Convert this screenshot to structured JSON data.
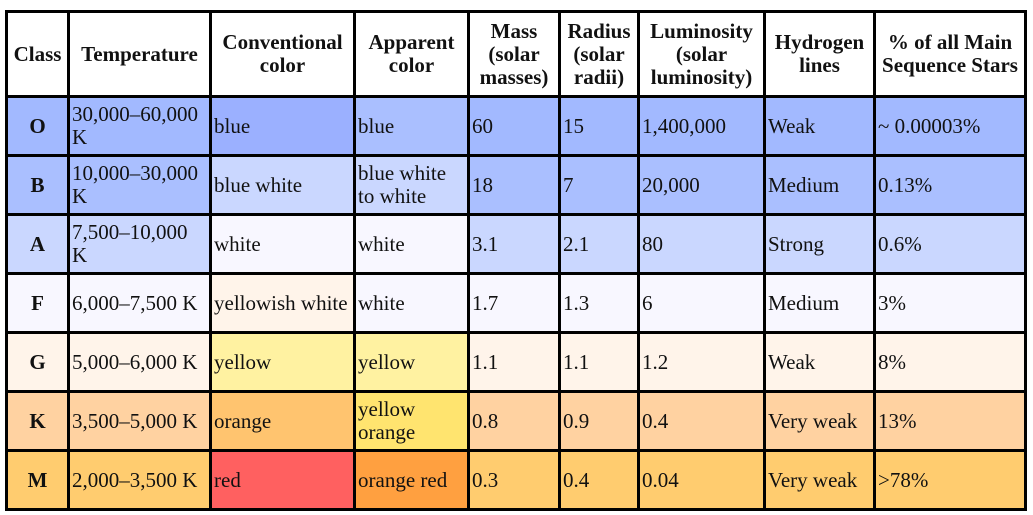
{
  "headers": [
    "Class",
    "Temperature",
    "Conventional color",
    "Apparent color",
    "Mass (solar masses)",
    "Radius (solar radii)",
    "Luminosity (solar luminosity)",
    "Hydrogen lines",
    "% of all Main Sequence Stars"
  ],
  "rows": [
    {
      "cls": "O",
      "temp": "30,000–60,000 K",
      "conv": "blue",
      "app": "blue",
      "mass": "60",
      "radius": "15",
      "lum": "1,400,000",
      "hyd": "Weak",
      "pct": "~ 0.00003%",
      "row_bg": "#a2b9ff",
      "conv_bg": "#9bb0ff",
      "app_bg": "#aabfff"
    },
    {
      "cls": "B",
      "temp": "10,000–30,000 K",
      "conv": "blue white",
      "app": "blue white to white",
      "mass": "18",
      "radius": "7",
      "lum": "20,000",
      "hyd": "Medium",
      "pct": "0.13%",
      "row_bg": "#aabfff",
      "conv_bg": "#cad7ff",
      "app_bg": "#cad7ff"
    },
    {
      "cls": "A",
      "temp": "7,500–10,000 K",
      "conv": "white",
      "app": "white",
      "mass": "3.1",
      "radius": "2.1",
      "lum": "80",
      "hyd": "Strong",
      "pct": "0.6%",
      "row_bg": "#cad7ff",
      "conv_bg": "#f8f7ff",
      "app_bg": "#f8f7ff"
    },
    {
      "cls": "F",
      "temp": "6,000–7,500 K",
      "conv": "yellowish white",
      "app": "white",
      "mass": "1.7",
      "radius": "1.3",
      "lum": "6",
      "hyd": "Medium",
      "pct": "3%",
      "row_bg": "#f8f7ff",
      "conv_bg": "#fff4ea",
      "app_bg": "#f8f7ff"
    },
    {
      "cls": "G",
      "temp": "5,000–6,000 K",
      "conv": "yellow",
      "app": "yellow",
      "mass": "1.1",
      "radius": "1.1",
      "lum": "1.2",
      "hyd": "Weak",
      "pct": "8%",
      "row_bg": "#fff4ea",
      "conv_bg": "#fff2a1",
      "app_bg": "#fff2a1"
    },
    {
      "cls": "K",
      "temp": "3,500–5,000 K",
      "conv": "orange",
      "app": "yellow orange",
      "mass": "0.8",
      "radius": "0.9",
      "lum": "0.4",
      "hyd": "Very weak",
      "pct": "13%",
      "row_bg": "#ffd2a1",
      "conv_bg": "#ffc46f",
      "app_bg": "#ffe46f"
    },
    {
      "cls": "M",
      "temp": "2,000–3,500 K",
      "conv": "red",
      "app": "orange red",
      "mass": "0.3",
      "radius": "0.4",
      "lum": "0.04",
      "hyd": "Very weak",
      "pct": ">78%",
      "row_bg": "#ffcc6f",
      "conv_bg": "#ff6060",
      "app_bg": "#ffa040"
    }
  ]
}
